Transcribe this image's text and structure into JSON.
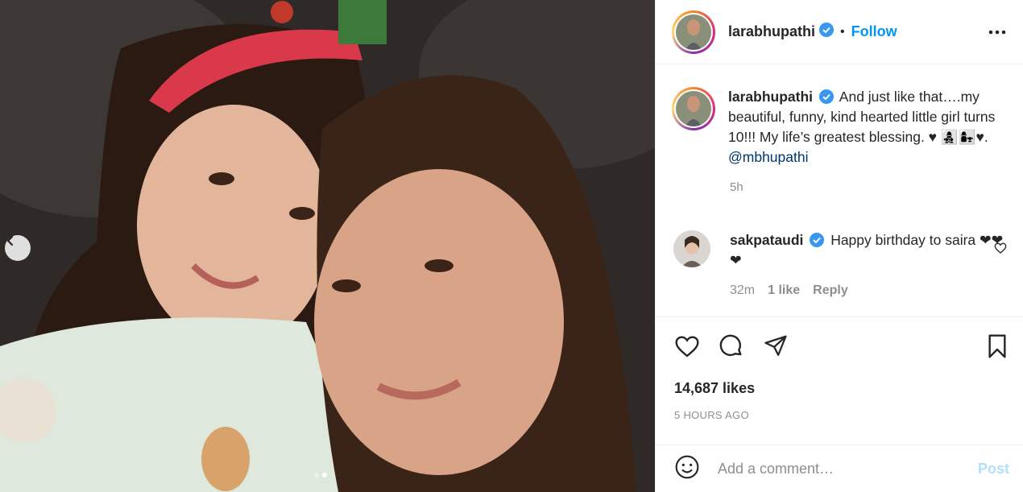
{
  "post": {
    "username": "larabhupathi",
    "follow_label": "Follow",
    "separator": "•",
    "caption_username": "larabhupathi",
    "caption_text": "And just like that….my beautiful, funny, kind hearted little girl turns 10!!! My life’s greatest blessing. ♥ 👩‍👧‍👦👩‍👧♥. ",
    "caption_mention": "@mbhupathi",
    "caption_time": "5h",
    "likes": "14,687 likes",
    "timestamp": "5 HOURS AGO"
  },
  "comment": {
    "username": "sakpataudi",
    "text": "Happy birthday to saira ❤❤❤",
    "time": "32m",
    "likes": "1 like",
    "reply_label": "Reply"
  },
  "composer": {
    "placeholder": "Add a comment…",
    "post_label": "Post"
  },
  "carousel": {
    "slide_count": 2,
    "active_slide": 2
  },
  "colors": {
    "accent": "#0095f6",
    "post_disabled": "#b2dffc",
    "muted": "#8e8e8e",
    "mention": "#00376b"
  },
  "icons": [
    "chevron-left-icon",
    "verified-icon",
    "more-icon",
    "heart-icon",
    "comment-icon",
    "share-icon",
    "bookmark-icon",
    "emoji-icon"
  ]
}
